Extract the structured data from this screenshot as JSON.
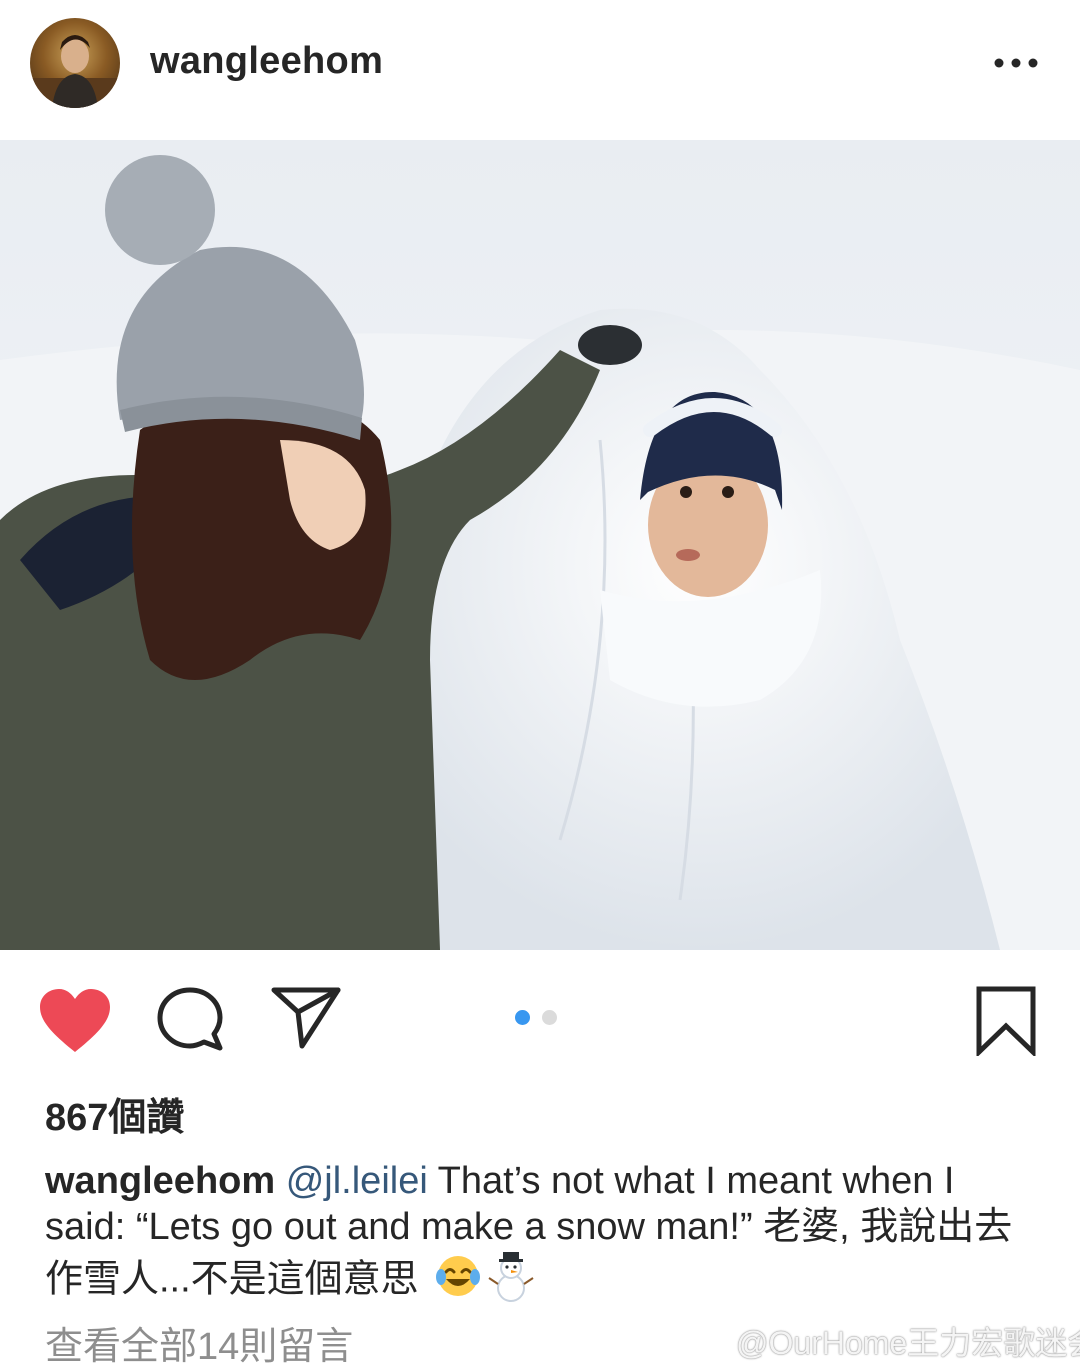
{
  "header": {
    "username": "wangleehom",
    "more_icon": "more-horizontal-icon"
  },
  "post": {
    "photo_subject": "snow-photo",
    "carousel": {
      "current": 1,
      "total": 2
    },
    "colors": {
      "like_red": "#ed4956",
      "dot_active": "#3897f0",
      "dot_inactive": "#dbdbdb",
      "mention_blue": "#36587a"
    }
  },
  "actions": {
    "like_icon": "heart-filled-icon",
    "comment_icon": "comment-icon",
    "share_icon": "send-icon",
    "save_icon": "bookmark-icon"
  },
  "likes_text": "867個讚",
  "caption": {
    "username": "wangleehom",
    "mention": "@jl.leilei",
    "text": " That’s not what I meant when I said: “Lets go out and make a snow man!” 老婆, 我說出去作雪人...不是這個意思 ",
    "emojis": [
      "laughing-tears-emoji",
      "snowman-emoji"
    ]
  },
  "view_comments": "查看全部14則留言",
  "watermark": "@OurHome王力宏歌迷会"
}
